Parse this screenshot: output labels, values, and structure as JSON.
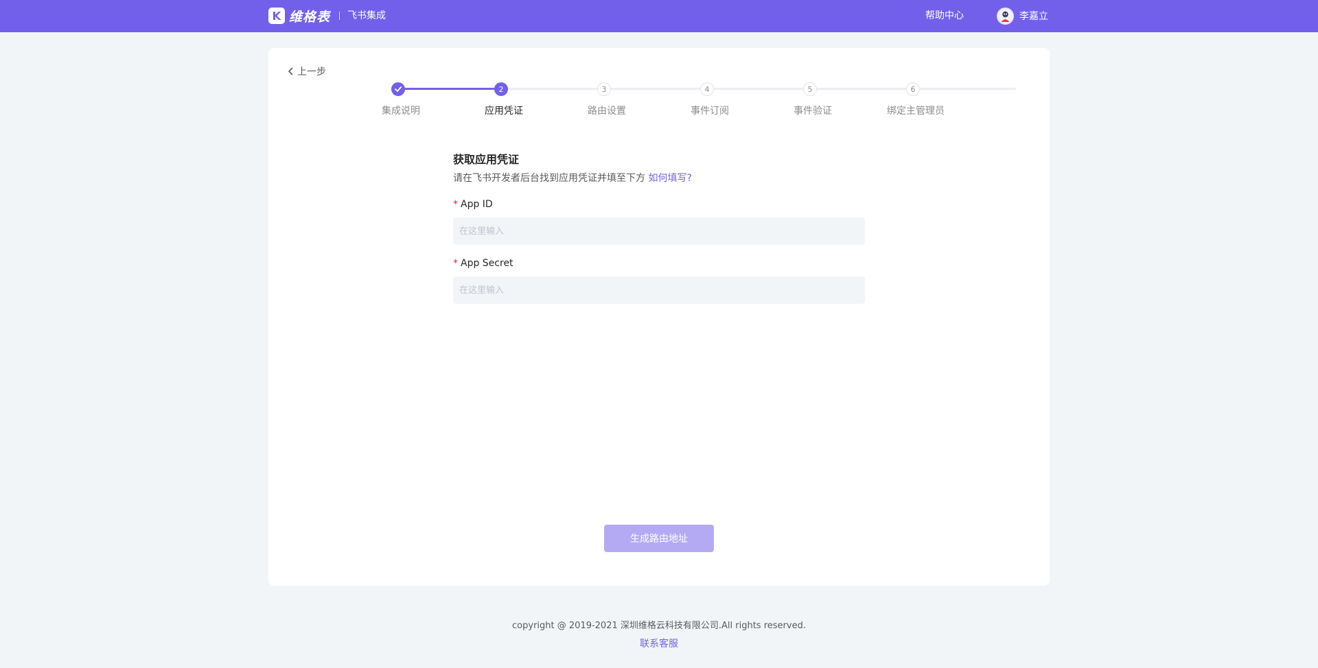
{
  "header": {
    "logo_text": "维格表",
    "product_name": "飞书集成",
    "help_label": "帮助中心",
    "user_name": "李嘉立",
    "accent_color": "#7360ea"
  },
  "nav": {
    "back_label": "上一步"
  },
  "steps": [
    {
      "number": "1",
      "label": "集成说明",
      "state": "done"
    },
    {
      "number": "2",
      "label": "应用凭证",
      "state": "active"
    },
    {
      "number": "3",
      "label": "路由设置",
      "state": "todo"
    },
    {
      "number": "4",
      "label": "事件订阅",
      "state": "todo"
    },
    {
      "number": "5",
      "label": "事件验证",
      "state": "todo"
    },
    {
      "number": "6",
      "label": "绑定主管理员",
      "state": "todo"
    }
  ],
  "form": {
    "title": "获取应用凭证",
    "description": "请在飞书开发者后台找到应用凭证并填至下方 ",
    "how_link": "如何填写?",
    "fields": [
      {
        "required_mark": "*",
        "label": "App ID",
        "value": "",
        "placeholder": "在这里输入"
      },
      {
        "required_mark": "*",
        "label": "App Secret",
        "value": "",
        "placeholder": "在这里输入"
      }
    ],
    "submit_label": "生成路由地址"
  },
  "footer": {
    "copyright": "copyright @ 2019-2021 深圳维格云科技有限公司.All rights reserved.",
    "contact_label": "联系客服"
  }
}
